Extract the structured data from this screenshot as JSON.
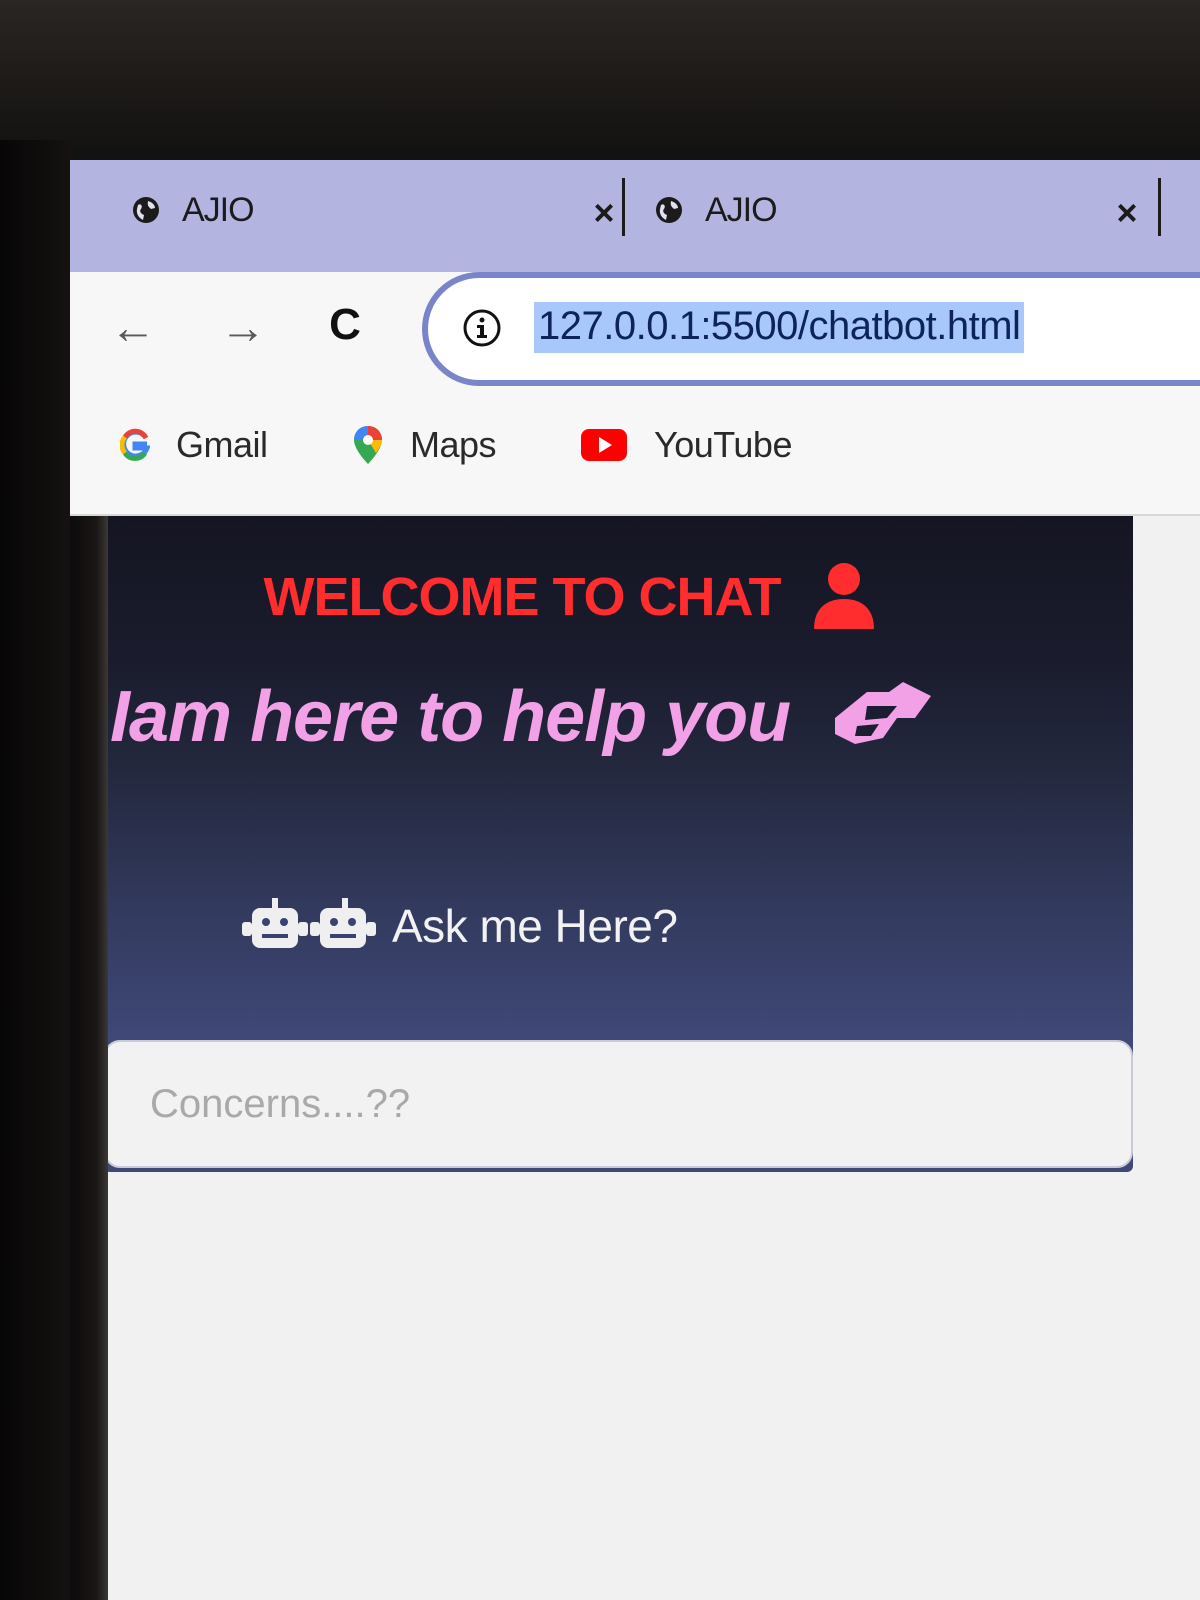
{
  "tabs": [
    {
      "title": "AJIO",
      "icon": "globe-icon",
      "close": "×"
    },
    {
      "title": "AJIO",
      "icon": "globe-icon",
      "close": "×"
    }
  ],
  "toolbar": {
    "back": "←",
    "forward": "→",
    "reload": "C",
    "url": "127.0.0.1:5500/chatbot.html"
  },
  "bookmarks": [
    {
      "label": "Gmail",
      "icon": "google-icon"
    },
    {
      "label": "Maps",
      "icon": "maps-pin-icon"
    },
    {
      "label": "YouTube",
      "icon": "youtube-icon"
    }
  ],
  "chat": {
    "welcome": "WELCOME TO CHAT",
    "help": "Iam here to help you",
    "ask": "Ask me Here?",
    "input_placeholder": "Concerns....??"
  },
  "colors": {
    "tab_strip": "#b3b5e0",
    "welcome_red": "#ff2d2d",
    "help_pink": "#f3a1e6",
    "panel_top": "#151522",
    "panel_bottom": "#414b7c",
    "url_highlight": "#a8c7fa"
  }
}
